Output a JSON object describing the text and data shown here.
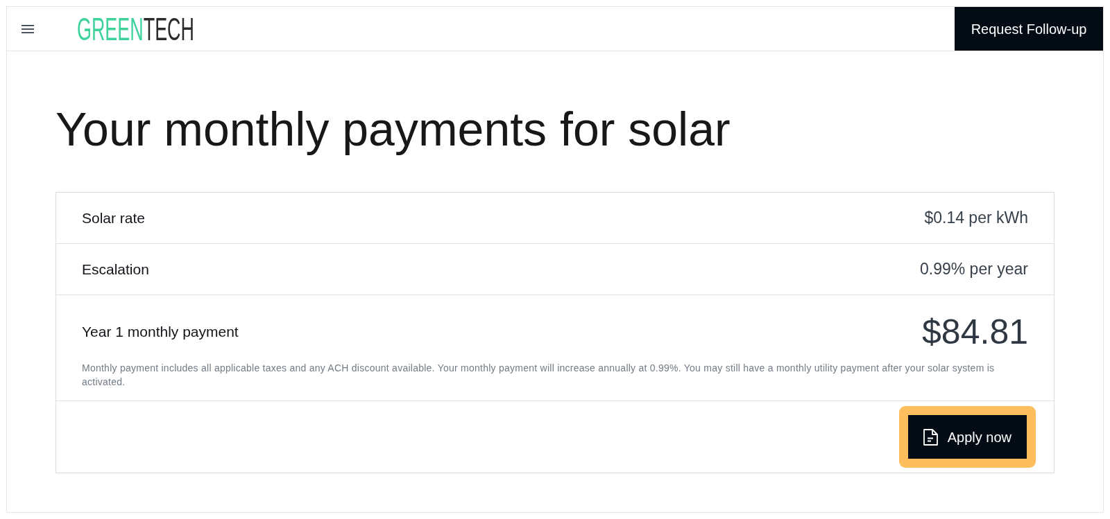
{
  "header": {
    "logo": {
      "segments": [
        {
          "text": "GREEN",
          "color": "#3fd39c"
        },
        {
          "text": "TECH",
          "color": "#2b2b2b"
        }
      ]
    },
    "action_button": "Request Follow-up"
  },
  "title": "Your monthly payments for solar",
  "rows": [
    {
      "kind": "detail",
      "label": "Solar rate",
      "value": "$0.14 per kWh"
    },
    {
      "kind": "detail",
      "label": "Escalation",
      "value": "0.99% per year"
    },
    {
      "kind": "total",
      "label": "Year 1 monthly payment",
      "value": "$84.81",
      "note": "Monthly payment includes all applicable taxes and any ACH discount available. Your monthly payment will increase annually at 0.99%. You may still have a monthly utility payment after your solar system is activated."
    }
  ],
  "apply_button": {
    "label": "Apply now",
    "highlighted": true
  }
}
